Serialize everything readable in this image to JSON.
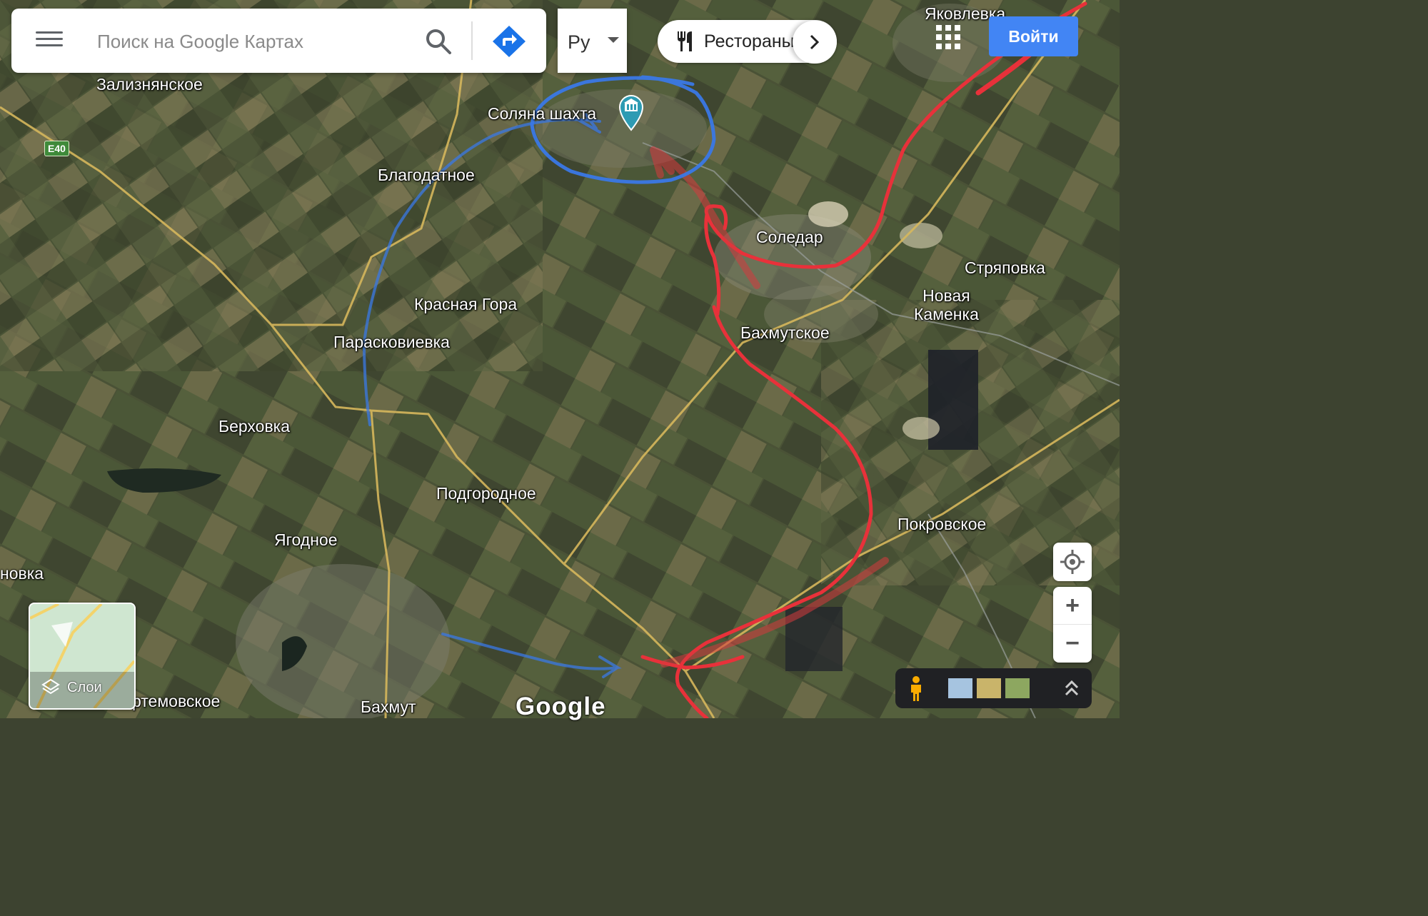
{
  "search": {
    "placeholder": "Поиск на Google Картах"
  },
  "language": {
    "label": "Ру"
  },
  "category_chip": {
    "label": "Рестораны"
  },
  "sign_in": {
    "label": "Войти"
  },
  "layers": {
    "label": "Слои"
  },
  "road_shield": "E40",
  "places": [
    {
      "name": "Яковлевка"
    },
    {
      "name": "Зализнянское"
    },
    {
      "name": "Соляна шахта"
    },
    {
      "name": "Благодатное"
    },
    {
      "name": "Соледар"
    },
    {
      "name": "Стряповка"
    },
    {
      "name": "Новая\nКаменка"
    },
    {
      "name": "Красная Гора"
    },
    {
      "name": "Парасковиевка"
    },
    {
      "name": "Бахмутское"
    },
    {
      "name": "Берховка"
    },
    {
      "name": "Подгородное"
    },
    {
      "name": "Покровское"
    },
    {
      "name": "Ягодное"
    },
    {
      "name": "новка"
    },
    {
      "name": "ртемовское"
    },
    {
      "name": "Бахмут"
    }
  ],
  "logo": "Google",
  "colors": {
    "accent": "#4285f4",
    "annotation_red": "#e8313a",
    "annotation_blue": "#3a78e6"
  },
  "icons": [
    "menu-icon",
    "search-icon",
    "directions-icon",
    "restaurant-icon",
    "chevron-right-icon",
    "apps-grid-icon",
    "my-location-icon",
    "pegman-icon",
    "expand-up-icon",
    "layers-icon",
    "museum-marker-icon"
  ]
}
